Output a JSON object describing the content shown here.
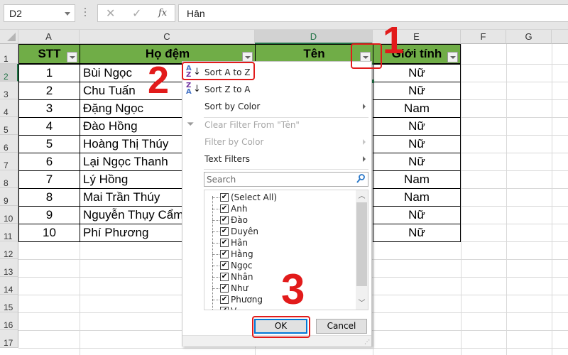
{
  "formula_bar": {
    "name_box": "D2",
    "cancel_icon": "✕",
    "enter_icon": "✓",
    "fx_label": "fx",
    "formula_value": "Hân"
  },
  "columns": [
    "A",
    "C",
    "D",
    "E",
    "F",
    "G"
  ],
  "rows": [
    "1",
    "2",
    "3",
    "4",
    "5",
    "6",
    "7",
    "8",
    "9",
    "10",
    "11",
    "12",
    "13",
    "14",
    "15",
    "16",
    "17"
  ],
  "table": {
    "headers": {
      "stt": "STT",
      "ho_dem": "Họ đệm",
      "ten": "Tên",
      "gioi_tinh": "Giới tính"
    },
    "records": [
      {
        "stt": "1",
        "ho_dem": "Bùi Ngọc",
        "gioi_tinh": "Nữ"
      },
      {
        "stt": "2",
        "ho_dem": "Chu Tuấn",
        "gioi_tinh": "Nữ"
      },
      {
        "stt": "3",
        "ho_dem": "Đặng Ngọc",
        "gioi_tinh": "Nam"
      },
      {
        "stt": "4",
        "ho_dem": "Đào Hồng",
        "gioi_tinh": "Nữ"
      },
      {
        "stt": "5",
        "ho_dem": "Hoàng Thị Thúy",
        "gioi_tinh": "Nữ"
      },
      {
        "stt": "6",
        "ho_dem": "Lại Ngọc Thanh",
        "gioi_tinh": "Nữ"
      },
      {
        "stt": "7",
        "ho_dem": "Lý Hồng",
        "gioi_tinh": "Nam"
      },
      {
        "stt": "8",
        "ho_dem": "Mai Trần Thúy",
        "gioi_tinh": "Nam"
      },
      {
        "stt": "9",
        "ho_dem": "Nguyễn Thụy Cẩm",
        "gioi_tinh": "Nữ"
      },
      {
        "stt": "10",
        "ho_dem": "Phí Phương",
        "gioi_tinh": "Nữ"
      }
    ]
  },
  "filter_menu": {
    "sort_az": "Sort A to Z",
    "sort_za": "Sort Z to A",
    "sort_by_color": "Sort by Color",
    "clear_filter": "Clear Filter From \"Tên\"",
    "filter_by_color": "Filter by Color",
    "text_filters": "Text Filters",
    "search_placeholder": "Search",
    "items": [
      "(Select All)",
      "Anh",
      "Đào",
      "Duyên",
      "Hân",
      "Hằng",
      "Ngọc",
      "Nhân",
      "Như",
      "Phương",
      "V..."
    ],
    "checked": true,
    "ok_label": "OK",
    "cancel_label": "Cancel"
  },
  "annotations": {
    "step1": "1",
    "step2": "2",
    "step3": "3"
  },
  "colors": {
    "header_green": "#70ad47",
    "annotation_red": "#e21b1b",
    "selection_green": "#217346"
  }
}
